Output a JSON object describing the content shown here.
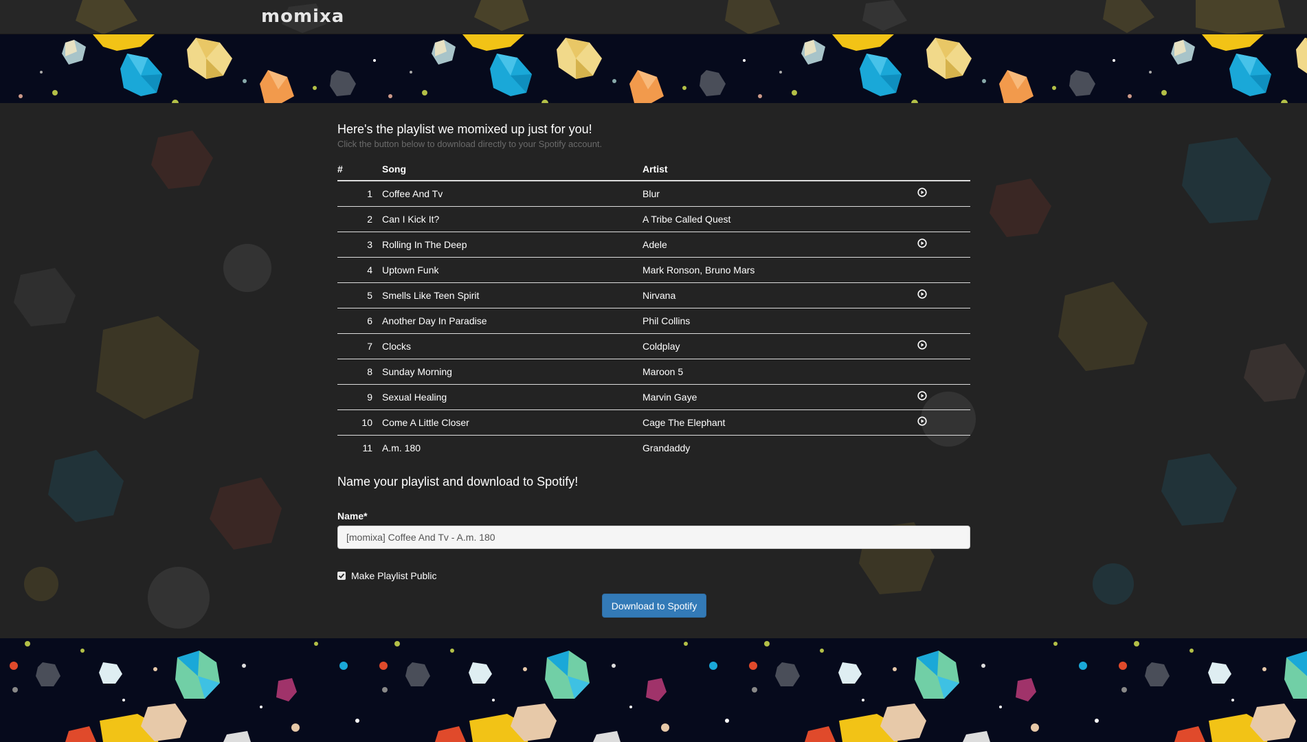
{
  "brand": {
    "name": "momixa"
  },
  "header": {
    "title": "Here's the playlist we momixed up just for you!",
    "subtitle": "Click the button below to download directly to your Spotify account."
  },
  "table": {
    "headers": {
      "num": "#",
      "song": "Song",
      "artist": "Artist"
    },
    "rows": [
      {
        "num": "1",
        "song": "Coffee And Tv",
        "artist": "Blur",
        "preview": true
      },
      {
        "num": "2",
        "song": "Can I Kick It?",
        "artist": "A Tribe Called Quest",
        "preview": false
      },
      {
        "num": "3",
        "song": "Rolling In The Deep",
        "artist": "Adele",
        "preview": true
      },
      {
        "num": "4",
        "song": "Uptown Funk",
        "artist": "Mark Ronson, Bruno Mars",
        "preview": false
      },
      {
        "num": "5",
        "song": "Smells Like Teen Spirit",
        "artist": "Nirvana",
        "preview": true
      },
      {
        "num": "6",
        "song": "Another Day In Paradise",
        "artist": "Phil Collins",
        "preview": false
      },
      {
        "num": "7",
        "song": "Clocks",
        "artist": "Coldplay",
        "preview": true
      },
      {
        "num": "8",
        "song": "Sunday Morning",
        "artist": "Maroon 5",
        "preview": false
      },
      {
        "num": "9",
        "song": "Sexual Healing",
        "artist": "Marvin Gaye",
        "preview": true
      },
      {
        "num": "10",
        "song": "Come A Little Closer",
        "artist": "Cage The Elephant",
        "preview": true
      },
      {
        "num": "11",
        "song": "A.m. 180",
        "artist": "Grandaddy",
        "preview": false
      }
    ]
  },
  "form": {
    "section_title": "Name your playlist and download to Spotify!",
    "name_label": "Name*",
    "name_value": "[momixa] Coffee And Tv - A.m. 180",
    "public_label": "Make Playlist Public",
    "public_checked": true,
    "download_label": "Download to Spotify"
  },
  "colors": {
    "background": "#232323",
    "banner": "#060a1c",
    "accent_button": "#337ab7"
  },
  "icons": {
    "play": "play-circle-icon",
    "check": "check-icon"
  }
}
